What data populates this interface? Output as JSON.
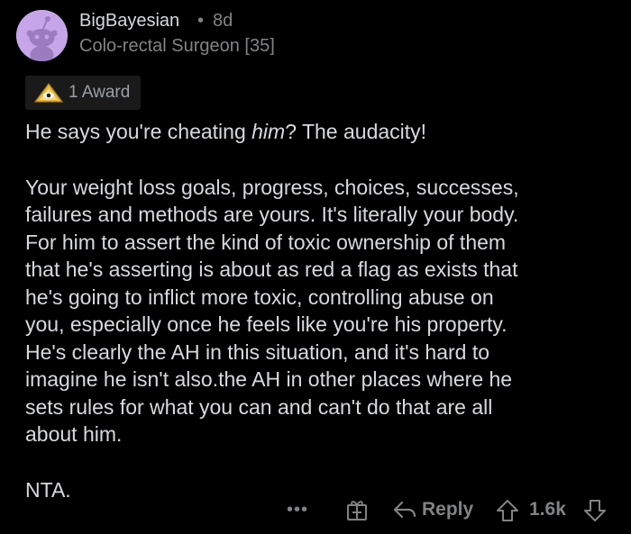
{
  "comment": {
    "author": "BigBayesian",
    "separator": "•",
    "age": "8d",
    "flair": "Colo-rectal Surgeon [35]",
    "award": {
      "label": "1 Award",
      "icon": "award-icon"
    },
    "body": {
      "p1_before": "He says you're cheating ",
      "p1_emphasis": "him",
      "p1_after": "? The audacity!",
      "p2": "Your weight loss goals, progress, choices, successes,\nfailures and methods are yours. It's literally your body.\nFor him to assert the kind of toxic ownership of them\nthat he's asserting is about as red a flag as exists that\nhe's going to inflict more toxic, controlling abuse on\nyou, especially once he feels like you're his property.\nHe's clearly the AH in this situation, and it's hard to\nimagine he isn't also.the AH in other places where he\nsets rules for what you can and can't do that are all\nabout him.",
      "p3": "NTA."
    },
    "actions": {
      "more_label": "•••",
      "gift_icon": "gift-icon",
      "reply_label": "Reply",
      "score": "1.6k"
    }
  },
  "colors": {
    "background": "#000000",
    "text": "#d7dadc",
    "muted": "#818384",
    "avatar": "#c6a6e8"
  }
}
